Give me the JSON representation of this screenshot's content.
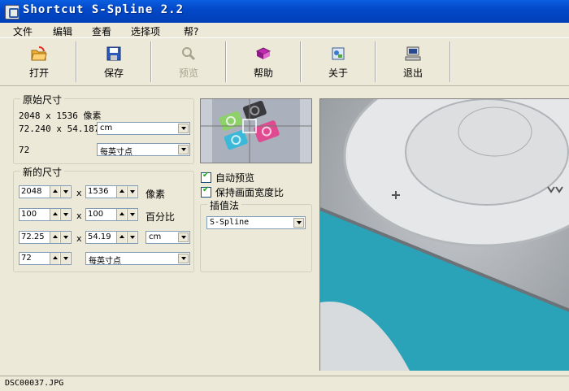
{
  "window": {
    "title": "Shortcut S-Spline 2.2"
  },
  "menu": [
    "文件",
    "编辑",
    "查看",
    "选择项",
    "帮?"
  ],
  "toolbar": [
    {
      "label": "打开",
      "icon": "open-folder-icon",
      "enabled": true
    },
    {
      "label": "保存",
      "icon": "floppy-save-icon",
      "enabled": true
    },
    {
      "label": "预览",
      "icon": "magnifier-icon",
      "enabled": false
    },
    {
      "label": "帮助",
      "icon": "help-book-icon",
      "enabled": true
    },
    {
      "label": "关于",
      "icon": "about-icon",
      "enabled": true
    },
    {
      "label": "退出",
      "icon": "exit-computer-icon",
      "enabled": true
    }
  ],
  "original_size": {
    "title": "原始尺寸",
    "pixels": "2048 x 1536 像素",
    "dimensions": "72.240 x 54.187",
    "unit": "cm",
    "resolution": "72",
    "resolution_unit": "每英寸点"
  },
  "new_size": {
    "title": "新的尺寸",
    "sep": "x",
    "pixel_w": "2048",
    "pixel_h": "1536",
    "pixel_unit": "像素",
    "pct_w": "100",
    "pct_h": "100",
    "pct_unit": "百分比",
    "dim_w": "72.25",
    "dim_h": "54.19",
    "dim_unit": "cm",
    "resolution": "72",
    "resolution_unit": "每英寸点"
  },
  "options": {
    "auto_preview": "自动预览",
    "keep_aspect": "保持画面宽度比",
    "auto_preview_checked": true,
    "keep_aspect_checked": true
  },
  "interpolation": {
    "title": "插值法",
    "value": "S-Spline"
  },
  "status": {
    "filename": "DSC00037.JPG"
  },
  "colors": {
    "title_bar": "#0348c8",
    "face": "#ece9d8",
    "field_border": "#7f9db9",
    "check_mark": "#21a121"
  }
}
